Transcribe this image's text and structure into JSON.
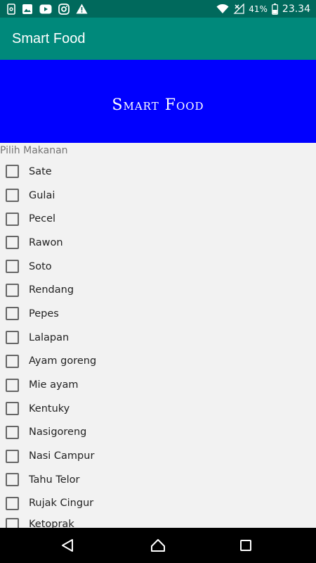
{
  "status_bar": {
    "left_icons": [
      "storage-icon",
      "image-icon",
      "youtube-icon",
      "instagram-icon",
      "warning-icon"
    ],
    "right_icons": [
      "wifi-icon",
      "no-signal-icon",
      "battery-icon"
    ],
    "battery_percent": "41%",
    "time": "23.34"
  },
  "app_bar": {
    "title": "Smart Food",
    "color": "#00897b"
  },
  "banner": {
    "title": "Smart Food",
    "color": "#0000ff"
  },
  "content": {
    "section_label": "Pilih Makanan",
    "items": [
      {
        "label": "Sate",
        "checked": false
      },
      {
        "label": "Gulai",
        "checked": false
      },
      {
        "label": "Pecel",
        "checked": false
      },
      {
        "label": "Rawon",
        "checked": false
      },
      {
        "label": "Soto",
        "checked": false
      },
      {
        "label": "Rendang",
        "checked": false
      },
      {
        "label": "Pepes",
        "checked": false
      },
      {
        "label": "Lalapan",
        "checked": false
      },
      {
        "label": "Ayam goreng",
        "checked": false
      },
      {
        "label": "Mie ayam",
        "checked": false
      },
      {
        "label": "Kentuky",
        "checked": false
      },
      {
        "label": "Nasigoreng",
        "checked": false
      },
      {
        "label": "Nasi Campur",
        "checked": false
      },
      {
        "label": "Tahu Telor",
        "checked": false
      },
      {
        "label": "Rujak Cingur",
        "checked": false
      },
      {
        "label": "Ketoprak",
        "checked": false
      }
    ]
  },
  "nav_bar": {
    "buttons": [
      "back-icon",
      "home-icon",
      "recents-icon"
    ]
  }
}
